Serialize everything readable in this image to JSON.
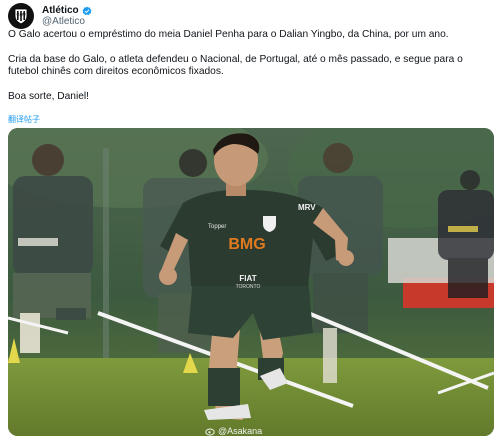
{
  "account": {
    "display_name": "Atlético",
    "handle": "@Atletico",
    "verified": true,
    "avatar_icon": "club-crest-icon"
  },
  "tweet": {
    "paragraphs": [
      "O Galo acertou o empréstimo do meia Daniel Penha para o Dalian Yingbo, da China, por um ano.",
      "Cria da base do Galo, o atleta defendeu o Nacional, de Portugal, até o mês passado, e segue para o futebol chinês com direitos econômicos fixados.",
      "Boa sorte, Daniel!"
    ],
    "translate_link": "翻译帖子"
  },
  "media": {
    "watermark": "@Asakana",
    "jersey_sponsor": "BMG",
    "jersey_brand": "Topper",
    "jersey_mrv": "MRV",
    "jersey_fiat": "FIAT",
    "jersey_fiat_sub": "TORONTO"
  },
  "colors": {
    "accent": "#1d9bf0",
    "jersey": "#2c3b30",
    "sponsor": "#e07a1f"
  }
}
